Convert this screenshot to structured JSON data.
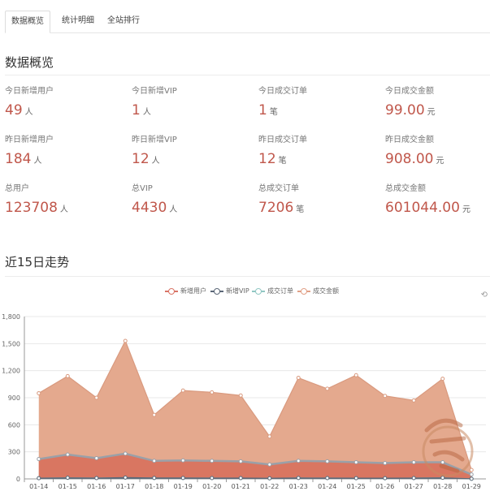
{
  "tabs": [
    "数据概览",
    "统计明细",
    "全站排行"
  ],
  "overview_title": "数据概览",
  "stats": [
    {
      "label": "今日新增用户",
      "value": "49",
      "unit": "人"
    },
    {
      "label": "今日新增VIP",
      "value": "1",
      "unit": "人"
    },
    {
      "label": "今日成交订单",
      "value": "1",
      "unit": "笔"
    },
    {
      "label": "今日成交金额",
      "value": "99.00",
      "unit": "元"
    },
    {
      "label": "昨日新增用户",
      "value": "184",
      "unit": "人"
    },
    {
      "label": "昨日新增VIP",
      "value": "12",
      "unit": "人"
    },
    {
      "label": "昨日成交订单",
      "value": "12",
      "unit": "笔"
    },
    {
      "label": "昨日成交金额",
      "value": "908.00",
      "unit": "元"
    },
    {
      "label": "总用户",
      "value": "123708",
      "unit": "人"
    },
    {
      "label": "总VIP",
      "value": "4430",
      "unit": "人"
    },
    {
      "label": "总成交订单",
      "value": "7206",
      "unit": "笔"
    },
    {
      "label": "总成交金额",
      "value": "601044.00",
      "unit": "元"
    }
  ],
  "trend_title": "近15日走势",
  "colors": {
    "accent": "#c0574b",
    "amount": "#e1a087",
    "users": "#d97466",
    "vip": "#5b6777",
    "orders": "#91c7c3"
  },
  "chart_data": {
    "type": "area",
    "categories": [
      "01-14",
      "01-15",
      "01-16",
      "01-17",
      "01-18",
      "01-19",
      "01-20",
      "01-21",
      "01-22",
      "01-23",
      "01-24",
      "01-25",
      "01-26",
      "01-27",
      "01-28",
      "01-29"
    ],
    "ylim": [
      0,
      1800
    ],
    "yticks": [
      0,
      300,
      600,
      900,
      1200,
      1500,
      1800
    ],
    "ytick_labels": [
      "0",
      "300",
      "600",
      "900",
      "1,200",
      "1,500",
      "1,800"
    ],
    "grid": true,
    "legend_position": "top-center",
    "series": [
      {
        "name": "新增用户",
        "color": "#d97466",
        "values": [
          220,
          270,
          230,
          280,
          200,
          205,
          200,
          195,
          160,
          200,
          195,
          185,
          175,
          185,
          184,
          49
        ]
      },
      {
        "name": "新增VIP",
        "color": "#5b6777",
        "values": [
          8,
          12,
          9,
          15,
          10,
          10,
          9,
          9,
          7,
          10,
          9,
          8,
          8,
          9,
          12,
          1
        ]
      },
      {
        "name": "成交订单",
        "color": "#91c7c3",
        "values": [
          8,
          11,
          9,
          14,
          9,
          9,
          9,
          8,
          6,
          10,
          9,
          8,
          7,
          9,
          12,
          1
        ]
      },
      {
        "name": "成交金额",
        "color": "#e1a087",
        "values": [
          950,
          1140,
          900,
          1530,
          710,
          980,
          960,
          925,
          470,
          1120,
          1000,
          1150,
          920,
          870,
          1110,
          99
        ]
      }
    ]
  },
  "icons": {
    "tool": "restore-icon"
  }
}
